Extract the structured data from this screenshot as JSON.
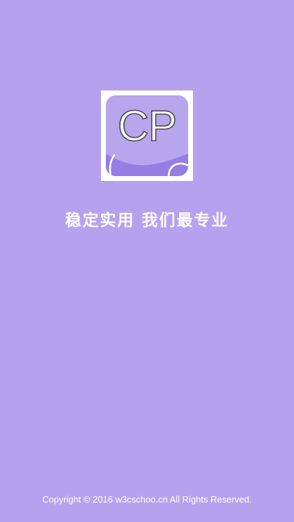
{
  "app": {
    "logo_text": "CP",
    "tagline": "稳定实用 我们最专业",
    "copyright": "Copyright © 2016 w3cschoo.cn All Rights Reserved."
  },
  "colors": {
    "background": "#b5a2ee",
    "logo_frame": "#ffffff",
    "logo_inner": "#b7a5ee",
    "text": "#ffffff"
  }
}
